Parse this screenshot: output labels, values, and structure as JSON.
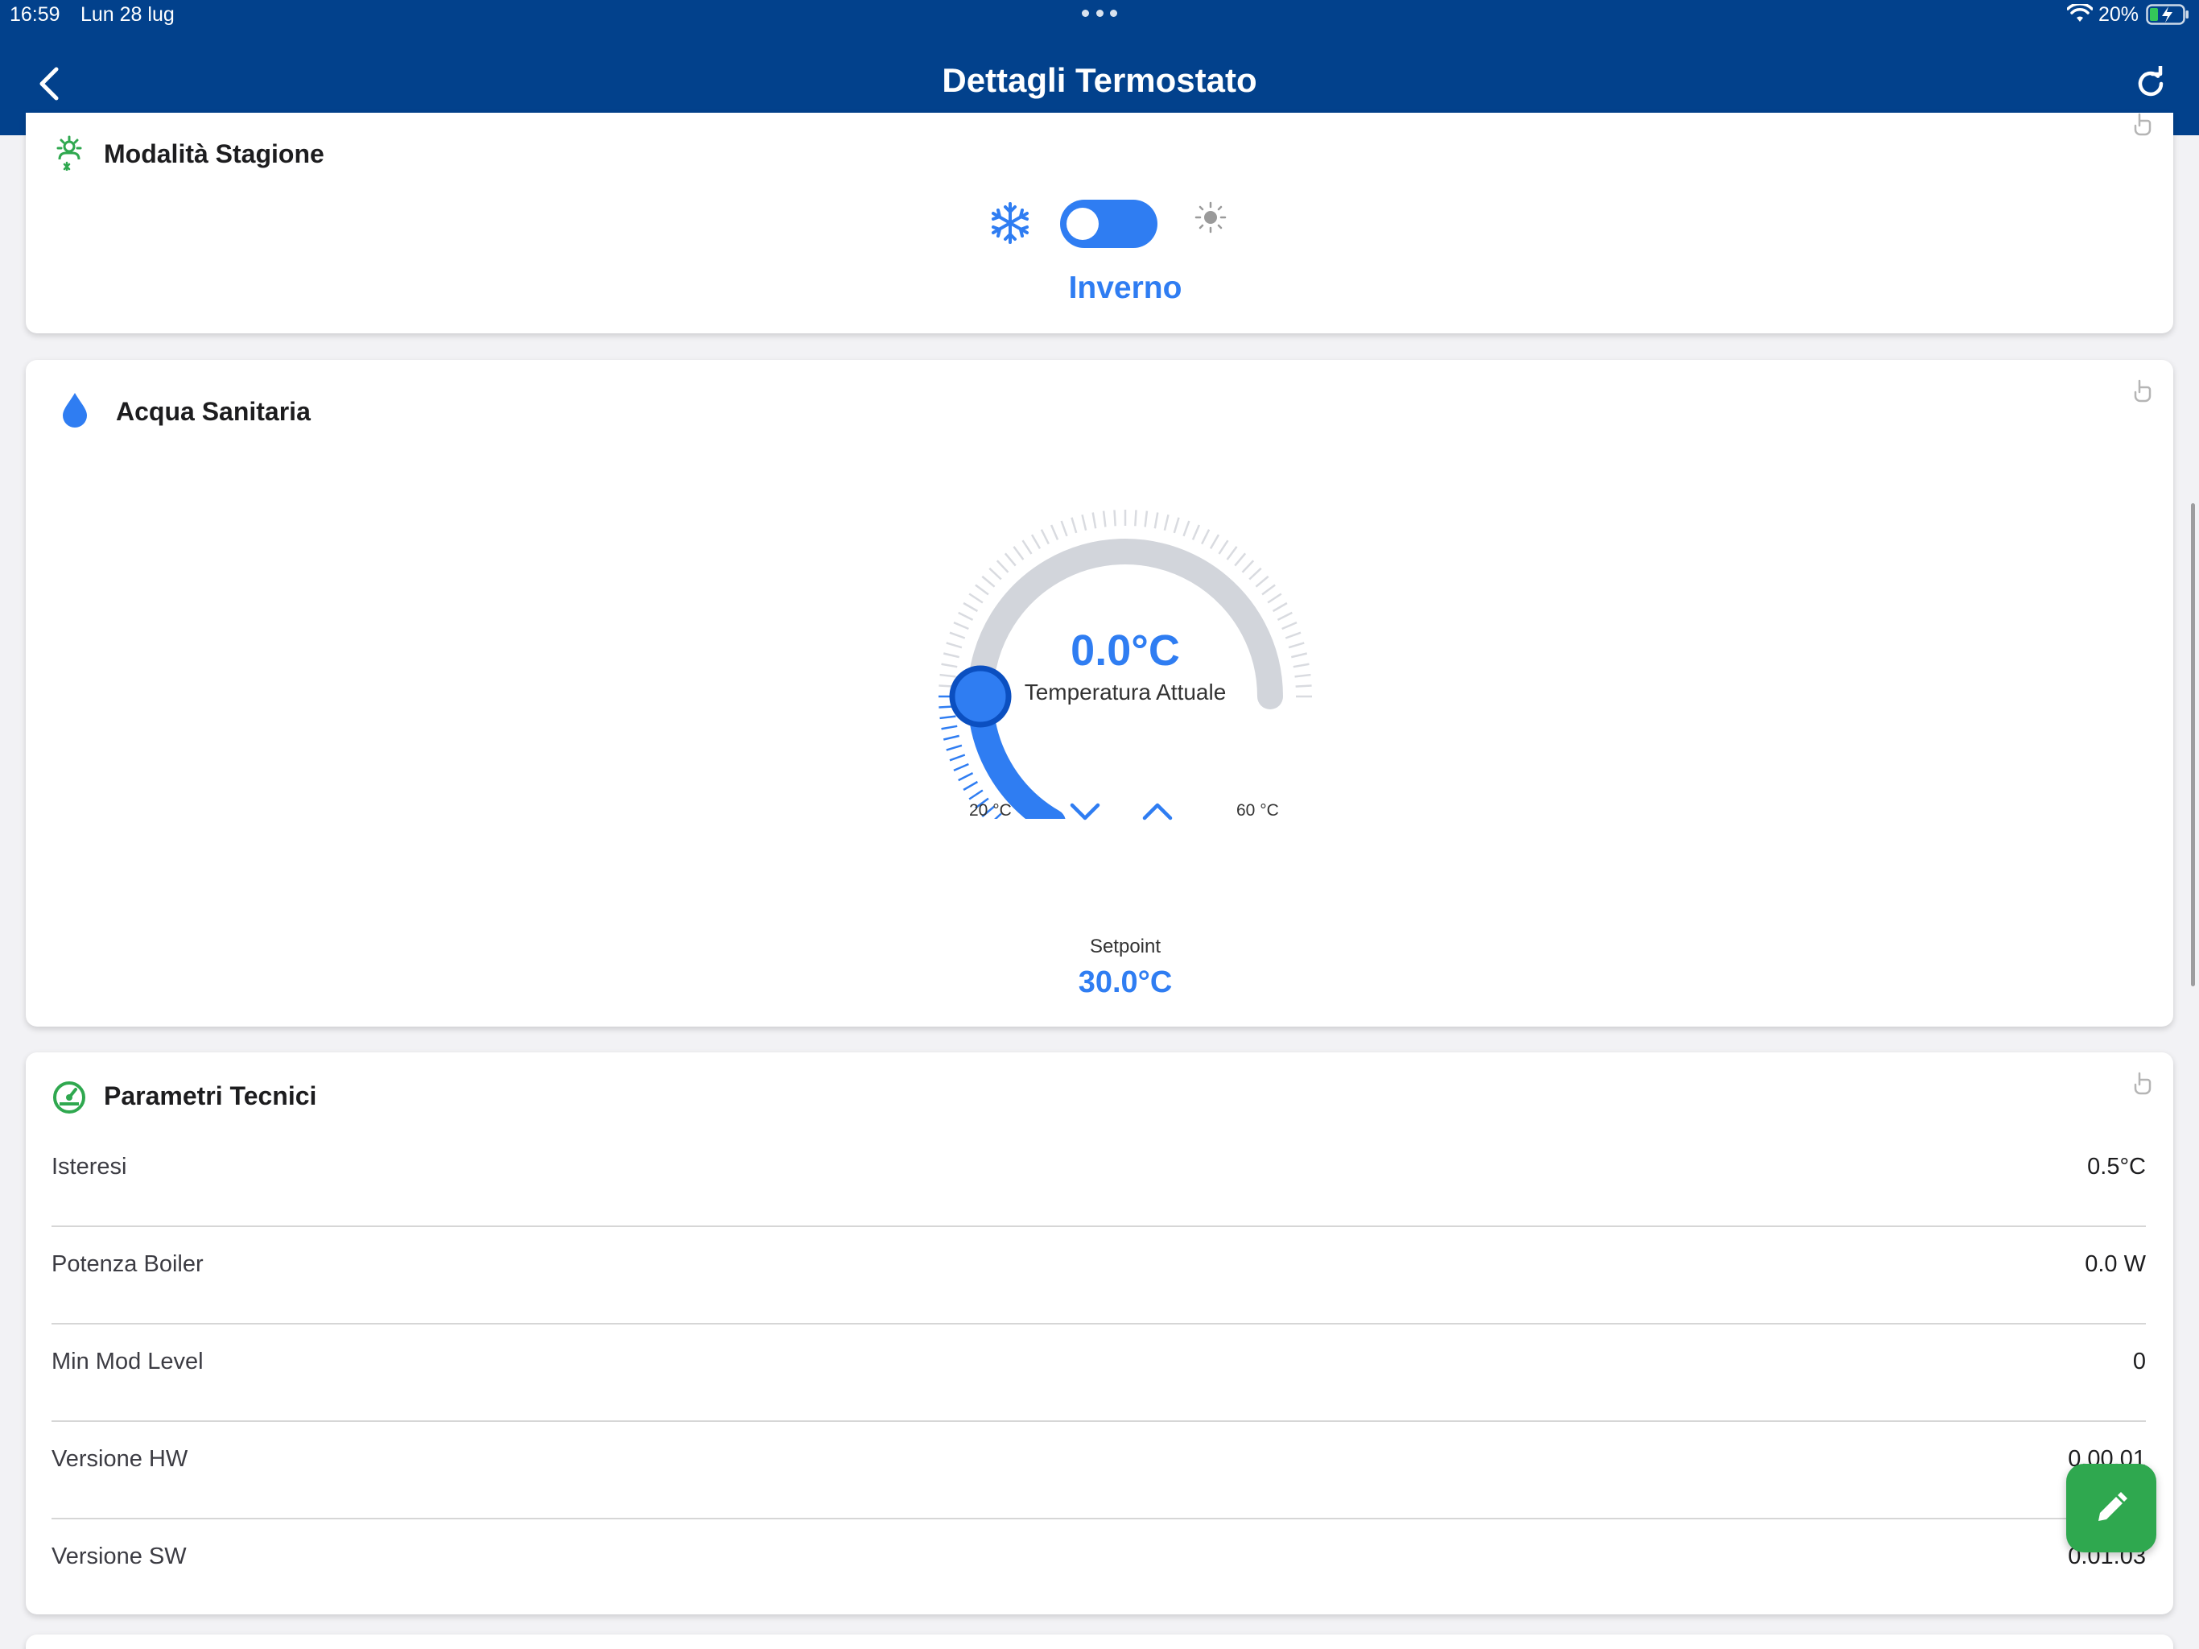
{
  "status_bar": {
    "time": "16:59",
    "date": "Lun 28 lug",
    "battery": "20%"
  },
  "header": {
    "title": "Dettagli Termostato"
  },
  "season_card": {
    "title": "Modalità Stagione",
    "mode_label": "Inverno",
    "winter_icon": "snowflake-icon",
    "summer_icon": "sun-icon"
  },
  "water_card": {
    "title": "Acqua Sanitaria",
    "icon": "water-drop-icon",
    "current_value": "0.0°C",
    "current_caption": "Temperatura Attuale",
    "min_label": "20 °C",
    "max_label": "60 °C",
    "setpoint_label": "Setpoint",
    "setpoint_value": "30.0°C",
    "setpoint_fraction": 0.25
  },
  "params_card": {
    "title": "Parametri Tecnici",
    "icon": "gauge-icon",
    "rows": [
      {
        "label": "Isteresi",
        "value": "0.5°C"
      },
      {
        "label": "Potenza Boiler",
        "value": "0.0 W"
      },
      {
        "label": "Min Mod Level",
        "value": "0"
      },
      {
        "label": "Versione HW",
        "value": "0.00.01"
      },
      {
        "label": "Versione SW",
        "value": "0.01.03"
      }
    ]
  },
  "colors": {
    "header": "#02418c",
    "accent": "#2f7df2",
    "green": "#2fa84f"
  }
}
